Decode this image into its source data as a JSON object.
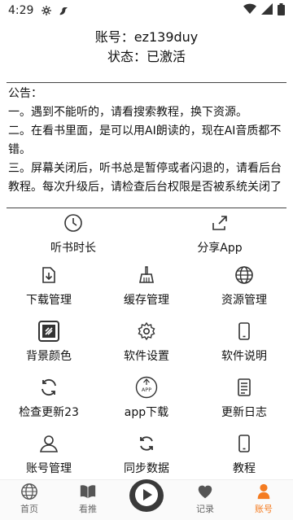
{
  "status_bar": {
    "time": "4:29"
  },
  "account": {
    "line1": "账号：ez139duy",
    "line2": "状态：已激活"
  },
  "notice": {
    "title": "公告：",
    "items": [
      "一。遇到不能听的，请看搜索教程，换下资源。",
      "二。在看书里面，是可以用AI朗读的，现在AI音质都不错。",
      "三。屏幕关闭后，听书总是暂停或者闪退的，请看后台教程。每次升级后，请检查后台权限是否被系统关闭了"
    ]
  },
  "grid": {
    "row1": [
      {
        "label": "听书时长",
        "icon": "clock-icon"
      },
      {
        "label": "分享App",
        "icon": "share-icon"
      }
    ],
    "rows": [
      [
        {
          "label": "下载管理",
          "icon": "download-icon"
        },
        {
          "label": "缓存管理",
          "icon": "broom-icon"
        },
        {
          "label": "资源管理",
          "icon": "globe-icon"
        }
      ],
      [
        {
          "label": "背景颜色",
          "icon": "palette-icon"
        },
        {
          "label": "软件设置",
          "icon": "gear-icon"
        },
        {
          "label": "软件说明",
          "icon": "phone-icon"
        }
      ],
      [
        {
          "label": "检查更新23",
          "icon": "refresh-icon"
        },
        {
          "label": "app下载",
          "icon": "app-download-icon"
        },
        {
          "label": "更新日志",
          "icon": "document-icon"
        }
      ],
      [
        {
          "label": "账号管理",
          "icon": "user-icon"
        },
        {
          "label": "同步数据",
          "icon": "sync-icon"
        },
        {
          "label": "教程",
          "icon": "phone-icon"
        }
      ]
    ]
  },
  "nav": {
    "tabs": [
      {
        "label": "首页",
        "icon": "globe-icon"
      },
      {
        "label": "看推",
        "icon": "book-icon"
      },
      {
        "label": "",
        "icon": "play-icon"
      },
      {
        "label": "记录",
        "icon": "heart-icon"
      },
      {
        "label": "账号",
        "icon": "user-icon"
      }
    ],
    "active_color": "#f47b20"
  }
}
